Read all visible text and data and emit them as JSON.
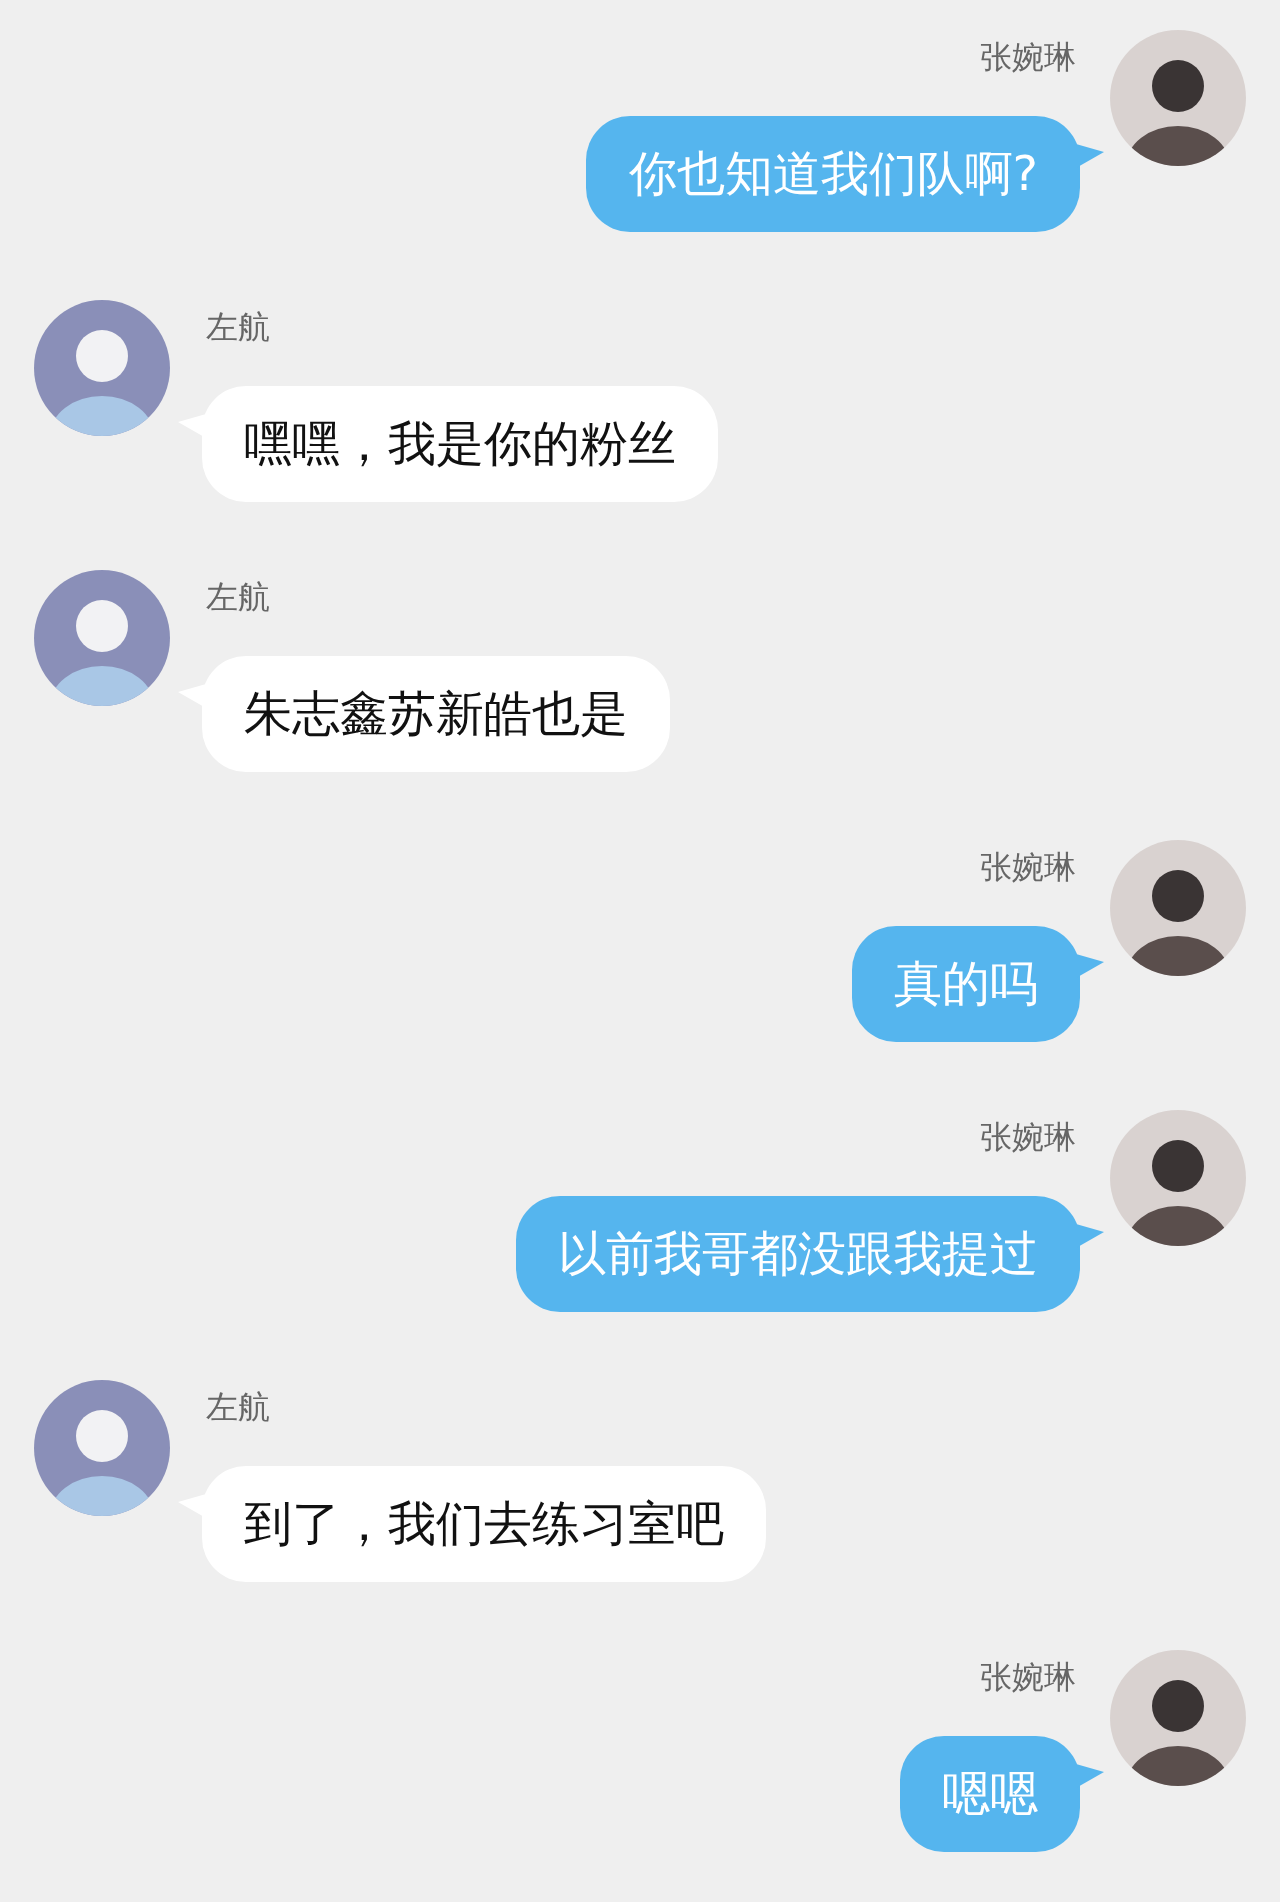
{
  "messages": [
    {
      "kind": "outgoing",
      "sender": "张婉琳",
      "text": "你也知道我们队啊?"
    },
    {
      "kind": "incoming",
      "sender": "左航",
      "text": "嘿嘿，我是你的粉丝"
    },
    {
      "kind": "incoming",
      "sender": "左航",
      "text": "朱志鑫苏新皓也是"
    },
    {
      "kind": "outgoing",
      "sender": "张婉琳",
      "text": "真的吗"
    },
    {
      "kind": "outgoing",
      "sender": "张婉琳",
      "text": "以前我哥都没跟我提过"
    },
    {
      "kind": "incoming",
      "sender": "左航",
      "text": "到了，我们去练习室吧"
    },
    {
      "kind": "outgoing",
      "sender": "张婉琳",
      "text": "嗯嗯"
    }
  ]
}
